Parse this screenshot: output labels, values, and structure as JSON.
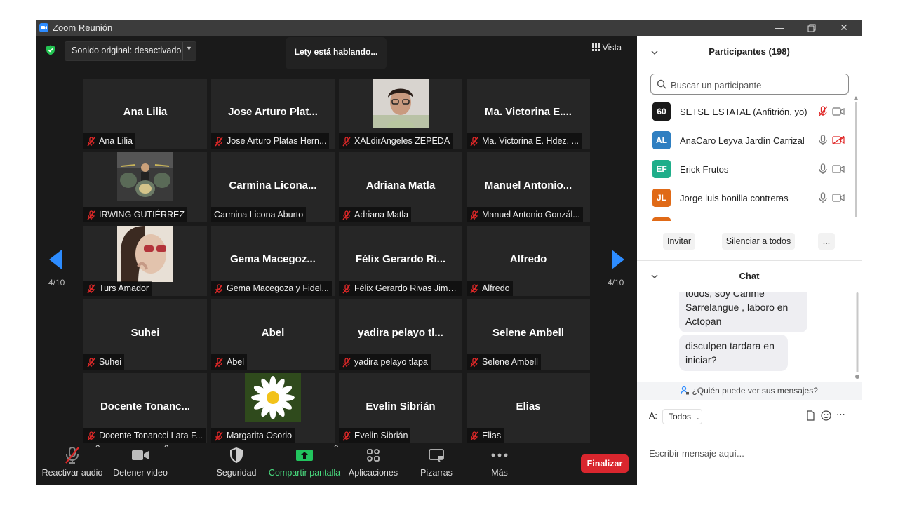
{
  "window": {
    "title": "Zoom Reunión"
  },
  "meeting": {
    "sound_original": "Sonido original: desactivado",
    "speaking": "Lety está hablando...",
    "view": "Vista",
    "page_left": "4/10",
    "page_right": "4/10"
  },
  "tiles": [
    {
      "big": "Ana Lilia",
      "label": "Ana Lilia"
    },
    {
      "big": "Jose Arturo Plat...",
      "label": "Jose Arturo Platas Hern..."
    },
    {
      "big": "",
      "label": "XALdirAngeles ZEPEDA",
      "photo": "woman-glasses"
    },
    {
      "big": "Ma. Victorina E....",
      "label": "Ma. Victorina E. Hdez. ..."
    },
    {
      "big": "",
      "label": "IRWING GUTIÉRREZ",
      "photo": "drums"
    },
    {
      "big": "Carmina Licona...",
      "label": "Carmina Licona Aburto",
      "nomic": true
    },
    {
      "big": "Adriana Matla",
      "label": "Adriana Matla"
    },
    {
      "big": "Manuel Antonio...",
      "label": "Manuel Antonio Gonzál..."
    },
    {
      "big": "",
      "label": "Turs Amador",
      "photo": "sunglasses"
    },
    {
      "big": "Gema Macegoz...",
      "label": "Gema Macegoza y Fidel..."
    },
    {
      "big": "Félix Gerardo Ri...",
      "label": "Félix Gerardo Rivas Jimé..."
    },
    {
      "big": "Alfredo",
      "label": "Alfredo"
    },
    {
      "big": "Suhei",
      "label": "Suhei"
    },
    {
      "big": "Abel",
      "label": "Abel"
    },
    {
      "big": "yadira pelayo tl...",
      "label": "yadira pelayo tlapa"
    },
    {
      "big": "Selene Ambell",
      "label": "Selene Ambell"
    },
    {
      "big": "Docente Tonanc...",
      "label": "Docente Tonancci Lara F..."
    },
    {
      "big": "",
      "label": "Margarita Osorio",
      "photo": "daisy"
    },
    {
      "big": "Evelin Sibrián",
      "label": "Evelin Sibrián"
    },
    {
      "big": "Elias",
      "label": "Elias"
    }
  ],
  "toolbar": {
    "audio": "Reactivar audio",
    "video": "Detener video",
    "security": "Seguridad",
    "share": "Compartir pantalla",
    "apps": "Aplicaciones",
    "whiteboards": "Pizarras",
    "more": "Más",
    "end": "Finalizar"
  },
  "participants": {
    "header": "Participantes (198)",
    "search_placeholder": "Buscar un participante",
    "list": [
      {
        "name": "SETSE ESTATAL (Anfitrión, yo)",
        "initials": "60",
        "color": "#1a1a1a",
        "mic_muted": true,
        "cam_off": false
      },
      {
        "name": "AnaCaro Leyva Jardín Carrizal",
        "initials": "AL",
        "color": "#2f7fc1",
        "mic_muted": false,
        "cam_off": true
      },
      {
        "name": "Erick Frutos",
        "initials": "EF",
        "color": "#1fae8a",
        "mic_muted": false,
        "cam_off": false
      },
      {
        "name": "Jorge luis bonilla contreras",
        "initials": "JL",
        "color": "#e06a17",
        "mic_muted": false,
        "cam_off": false
      }
    ],
    "invite": "Invitar",
    "mute_all": "Silenciar a todos",
    "more": "..."
  },
  "chat": {
    "header": "Chat",
    "messages": [
      {
        "text": "todos, soy Carime Sarrelangue , laboro en Actopan"
      },
      {
        "text": "disculpen tardara en iniciar?"
      }
    ],
    "who_can_see": "¿Quién puede ver sus mensajes?",
    "to_label": "A:",
    "to_value": "Todos",
    "input_placeholder": "Escribir mensaje aquí..."
  },
  "colors": {
    "accent": "#2d8cff",
    "end": "#d9262e",
    "share": "#22c55e",
    "muted": "#e02828"
  }
}
